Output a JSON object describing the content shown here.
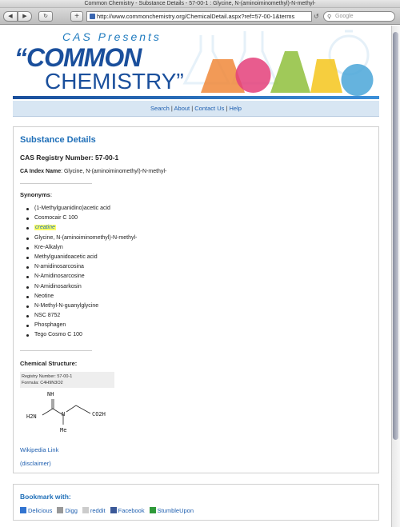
{
  "window": {
    "title": "Common Chemistry - Substance Details - 57-00-1 : Glycine, N-(aminoiminomethyl)-N-methyl-"
  },
  "toolbar": {
    "back_icon": "back-arrow-icon",
    "forward_icon": "forward-arrow-icon",
    "reload_icon": "reload-icon",
    "add_icon": "plus-icon",
    "url": "http://www.commonchemistry.org/ChemicalDetail.aspx?ref=57-00-1&terms",
    "search_placeholder": "Google"
  },
  "banner": {
    "presents": "CAS Presents",
    "line1": "“COMMON",
    "line2": "CHEMISTRY”",
    "flask_colors": [
      "#f0883a",
      "#e4407a",
      "#8fbf3c",
      "#f4c51c",
      "#4aa6d8"
    ]
  },
  "nav": {
    "items": [
      "Search",
      "About",
      "Contact Us",
      "Help"
    ],
    "separator": "|"
  },
  "content": {
    "heading": "Substance Details",
    "registry_number_label": "CAS Registry Number: 57-00-1",
    "index_name_label": "CA Index Name",
    "index_name_value": ": Glycine, N-(aminoiminomethyl)-N-methyl-",
    "synonyms_label": "Synonyms",
    "synonyms_colon": ":",
    "synonyms": [
      "(1-Methylguanidino)acetic acid",
      "Cosmocair C 100",
      "creatine",
      "Glycine, N-(aminoiminomethyl)-N-methyl-",
      "Kre-Alkalyn",
      "Methylguanidoacetic acid",
      "N-amidinosarcosina",
      "N-Amidinosarcosine",
      "N-Amidinosarkosin",
      "Neotine",
      "N-Methyl-N-guanylglycine",
      "NSC 8752",
      "Phosphagen",
      "Tego Cosmo C 100"
    ],
    "highlighted_synonym": "creatine",
    "structure_label": "Chemical Structure:",
    "structure_registry": "Registry Number: 57-00-1",
    "structure_formula": "Formula: C4H9N3O2",
    "structure_atoms": {
      "nh": "NH",
      "h2n": "H2N",
      "n": "N",
      "me": "Me",
      "co2h": "CO2H"
    },
    "wiki_link": "Wikipedia Link",
    "disclaimer_link": "(disclaimer)"
  },
  "bookmark": {
    "heading": "Bookmark with:",
    "services": [
      {
        "label": "Delicious",
        "icon": "delicious-icon",
        "color": "#3274d0"
      },
      {
        "label": "Digg",
        "icon": "digg-icon",
        "color": "#999999"
      },
      {
        "label": "reddit",
        "icon": "reddit-icon",
        "color": "#cccccc"
      },
      {
        "label": "Facebook",
        "icon": "facebook-icon",
        "color": "#3b5998"
      },
      {
        "label": "StumbleUpon",
        "icon": "stumbleupon-icon",
        "color": "#2f9a3a"
      }
    ]
  }
}
